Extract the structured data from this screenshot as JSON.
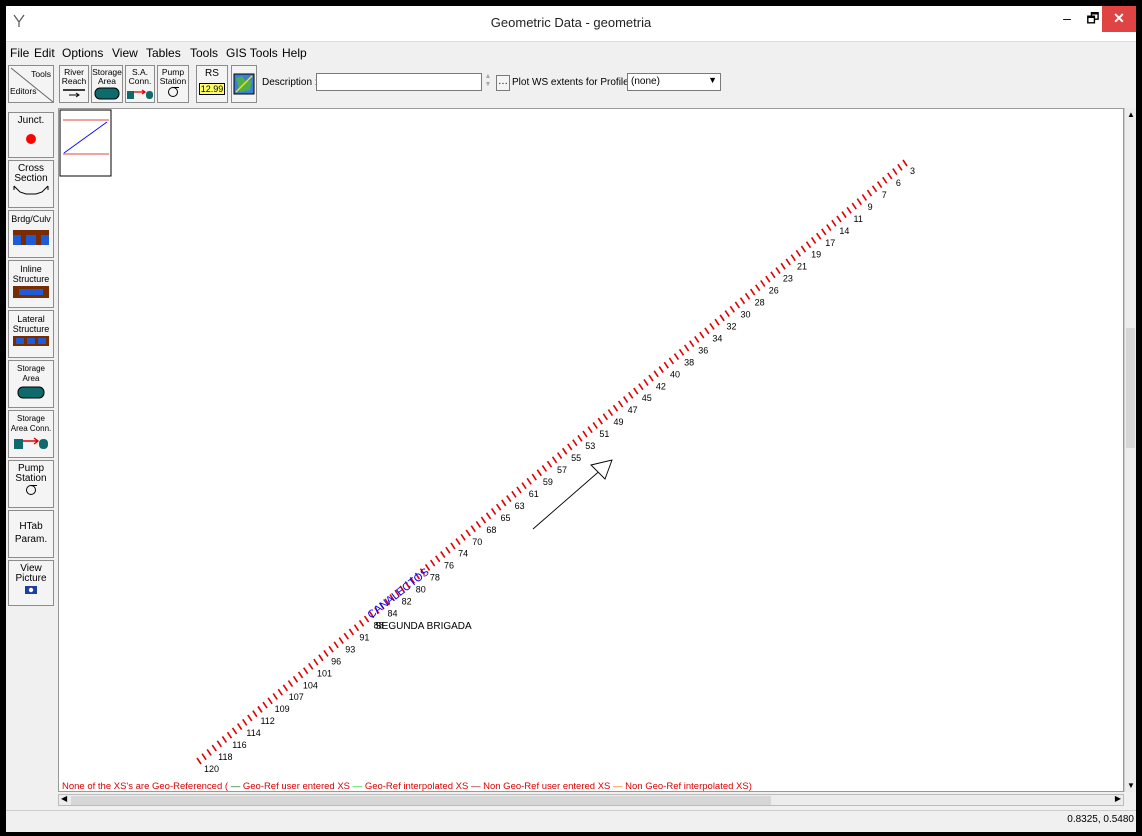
{
  "window": {
    "title": "Geometric Data - geometria",
    "buttons": {
      "minimize": "–",
      "maximize": "🗗",
      "close": "✕"
    }
  },
  "menu": [
    "File",
    "Edit",
    "Options",
    "View",
    "Tables",
    "Tools",
    "GIS Tools",
    "Help"
  ],
  "toolbar": {
    "tools_label": "Tools",
    "editors_label": "Editors",
    "river_reach": "River\nReach",
    "storage_area": "Storage\nArea",
    "sa_conn": "S.A.\nConn.",
    "pump_station": "Pump\nStation",
    "rs_label": "RS",
    "rs_value": "12.99",
    "description_label": "Description :",
    "description_value": "",
    "plot_ws_label": "Plot WS extents for Profile:",
    "profile_value": "(none)"
  },
  "left_toolbar": {
    "junct": "Junct.",
    "cross_section": "Cross\nSection",
    "brdg_culv": "Brdg/Culv",
    "inline_structure": "Inline\nStructure",
    "lateral_structure": "Lateral\nStructure",
    "storage_area": "Storage\nArea",
    "storage_area_conn": "Storage\nArea Conn.",
    "pump_station": "Pump\nStation",
    "htab_param": "HTab\nParam.",
    "view_picture": "View\nPicture"
  },
  "map": {
    "river_name": "CANALECTOS",
    "reach_name": "SEGUNDA BRIGADA",
    "station_labels": [
      "3",
      "6",
      "7",
      "9",
      "11",
      "14",
      "17",
      "19",
      "21",
      "23",
      "26",
      "28",
      "30",
      "32",
      "34",
      "36",
      "38",
      "40",
      "42",
      "45",
      "47",
      "49",
      "51",
      "53",
      "55",
      "57",
      "59",
      "61",
      "63",
      "65",
      "68",
      "70",
      "74",
      "76",
      "78",
      "80",
      "82",
      "84",
      "88",
      "91",
      "93",
      "96",
      "101",
      "104",
      "107",
      "109",
      "112",
      "114",
      "116",
      "118",
      "120"
    ]
  },
  "legend": {
    "prefix": "None of the XS's are Geo-Referenced (",
    "items": [
      {
        "label": "Geo-Ref user entered XS",
        "color": "#006400"
      },
      {
        "label": "Geo-Ref interpolated XS",
        "color": "#00cc00"
      },
      {
        "label": "Non Geo-Ref user entered XS",
        "color": "#8b0000"
      },
      {
        "label": "Non Geo-Ref interpolated XS)",
        "color": "#ff6a00"
      }
    ]
  },
  "status": {
    "coords": "0.8325, 0.5480"
  },
  "colors": {
    "xs": "#e00000",
    "river": "#0000ff",
    "close": "#e04343"
  }
}
